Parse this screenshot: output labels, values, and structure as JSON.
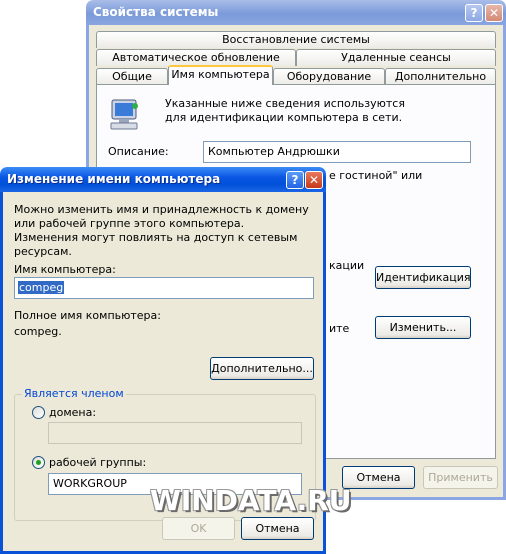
{
  "sys_window": {
    "title": "Свойства системы",
    "help_button": "?",
    "close_button": "✕",
    "tabs_row1": [
      "Восстановление системы"
    ],
    "tabs_row2": [
      "Автоматическое обновление",
      "Удаленные сеансы"
    ],
    "tabs_row3": [
      "Общие",
      "Имя компьютера",
      "Оборудование",
      "Дополнительно"
    ],
    "selected_tab": "Имя компьютера",
    "intro_text": "Указанные ниже сведения используются для идентификации компьютера в сети.",
    "description_label": "Описание:",
    "description_value": "Компьютер Андрюшки",
    "partial_text_1": "е гостиной\" или",
    "partial_text_2": "кации",
    "partial_text_3": "ите",
    "identification_button": "Идентификация",
    "change_button": "Изменить...",
    "cancel_button": "Отмена",
    "apply_button": "Применить"
  },
  "rename_dialog": {
    "title": "Изменение имени компьютера",
    "help_button": "?",
    "close_button": "✕",
    "intro_text": "Можно изменить имя и принадлежность к домену или рабочей группе этого компьютера. Изменения могут повлиять на доступ к сетевым ресурсам.",
    "computer_name_label": "Имя компьютера:",
    "computer_name_value": "compeg",
    "full_name_label": "Полное имя компьютера:",
    "full_name_value": "compeg.",
    "more_button": "Дополнительно...",
    "member_group_title": "Является членом",
    "domain_label": "домена:",
    "domain_value": "",
    "workgroup_label": "рабочей группы:",
    "workgroup_value": "WORKGROUP",
    "selected_membership": "workgroup",
    "ok_button": "OK",
    "cancel_button": "Отмена"
  },
  "watermark": "WINDATA.RU",
  "colors": {
    "title_active": "#0a58e3",
    "title_inactive": "#7b9ada",
    "dialog_face": "#ece9d8",
    "tab_highlight": "#ffc83c",
    "group_title": "#0046d5",
    "selection": "#316ac5"
  }
}
